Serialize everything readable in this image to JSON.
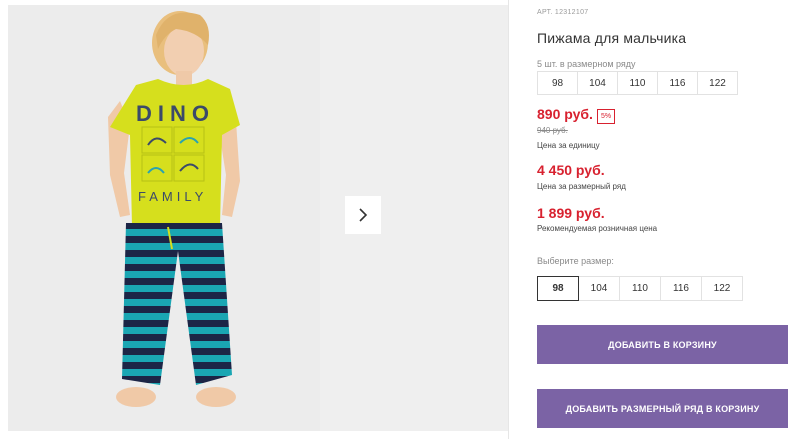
{
  "gallery": {
    "main_image_alt": "Boy wearing yellow DINO FAMILY t-shirt and striped pajama pants",
    "shirt_print": "DINO",
    "shirt_print_bottom": "FAMILY",
    "next_icon": "chevron-right-icon"
  },
  "product": {
    "article": "АРТ. 12312107",
    "title": "Пижама для мальчика",
    "pack_caption": "5 шт. в размерном ряду",
    "pack_sizes": [
      "98",
      "104",
      "110",
      "116",
      "122"
    ]
  },
  "prices": {
    "unit_price": "890 руб.",
    "discount": "5%",
    "old_price": "940 руб.",
    "unit_note": "Цена за единицу",
    "pack_price": "4 450 руб.",
    "pack_note": "Цена за размерный ряд",
    "rrp_price": "1 899 руб.",
    "rrp_note": "Рекомендуемая розничная цена"
  },
  "size_picker": {
    "label": "Выберите размер:",
    "options": [
      "98",
      "104",
      "110",
      "116",
      "122"
    ],
    "selected": "98"
  },
  "actions": {
    "add_to_cart": "ДОБАВИТЬ В КОРЗИНУ",
    "add_pack_to_cart": "ДОБАВИТЬ РАЗМЕРНЫЙ РЯД В КОРЗИНУ"
  },
  "colors": {
    "price_red": "#d8212f",
    "button_purple": "#7b63a5",
    "shirt_yellow": "#d9e21e",
    "stripe_teal": "#1aa6b3",
    "stripe_navy": "#1c2546"
  }
}
